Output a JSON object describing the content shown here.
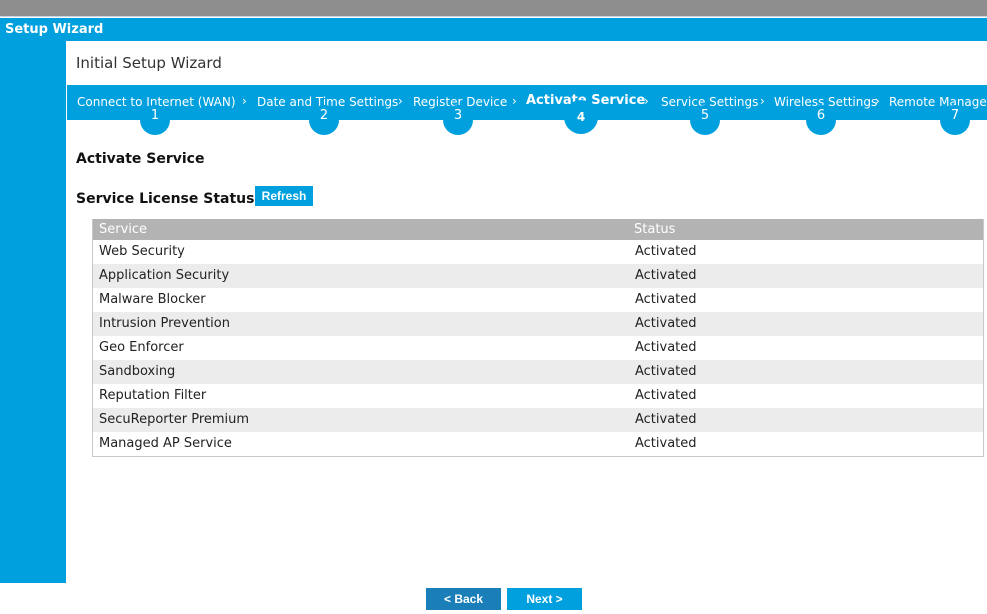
{
  "window_title": "l Setup Wizard",
  "page_title": "Initial Setup Wizard",
  "steps": [
    {
      "label": "Connect to Internet (WAN)",
      "number": "1"
    },
    {
      "label": "Date and Time Settings",
      "number": "2"
    },
    {
      "label": "Register Device",
      "number": "3"
    },
    {
      "label": "Activate Service",
      "number": "4"
    },
    {
      "label": "Service Settings",
      "number": "5"
    },
    {
      "label": "Wireless Settings",
      "number": "6"
    },
    {
      "label": "Remote Manage",
      "number": "7"
    }
  ],
  "section_title": "Activate Service",
  "license": {
    "title": "Service License Status",
    "refresh_label": "Refresh",
    "columns": [
      "Service",
      "Status"
    ],
    "rows": [
      [
        "Web Security",
        "Activated"
      ],
      [
        "Application Security",
        "Activated"
      ],
      [
        "Malware Blocker",
        "Activated"
      ],
      [
        "Intrusion Prevention",
        "Activated"
      ],
      [
        "Geo Enforcer",
        "Activated"
      ],
      [
        "Sandboxing",
        "Activated"
      ],
      [
        "Reputation Filter",
        "Activated"
      ],
      [
        "SecuReporter Premium",
        "Activated"
      ],
      [
        "Managed AP Service",
        "Activated"
      ]
    ]
  },
  "nav": {
    "back_label": "< Back",
    "next_label": "Next >"
  },
  "colors": {
    "accent": "#00a0df",
    "back": "#1a7fb8"
  }
}
